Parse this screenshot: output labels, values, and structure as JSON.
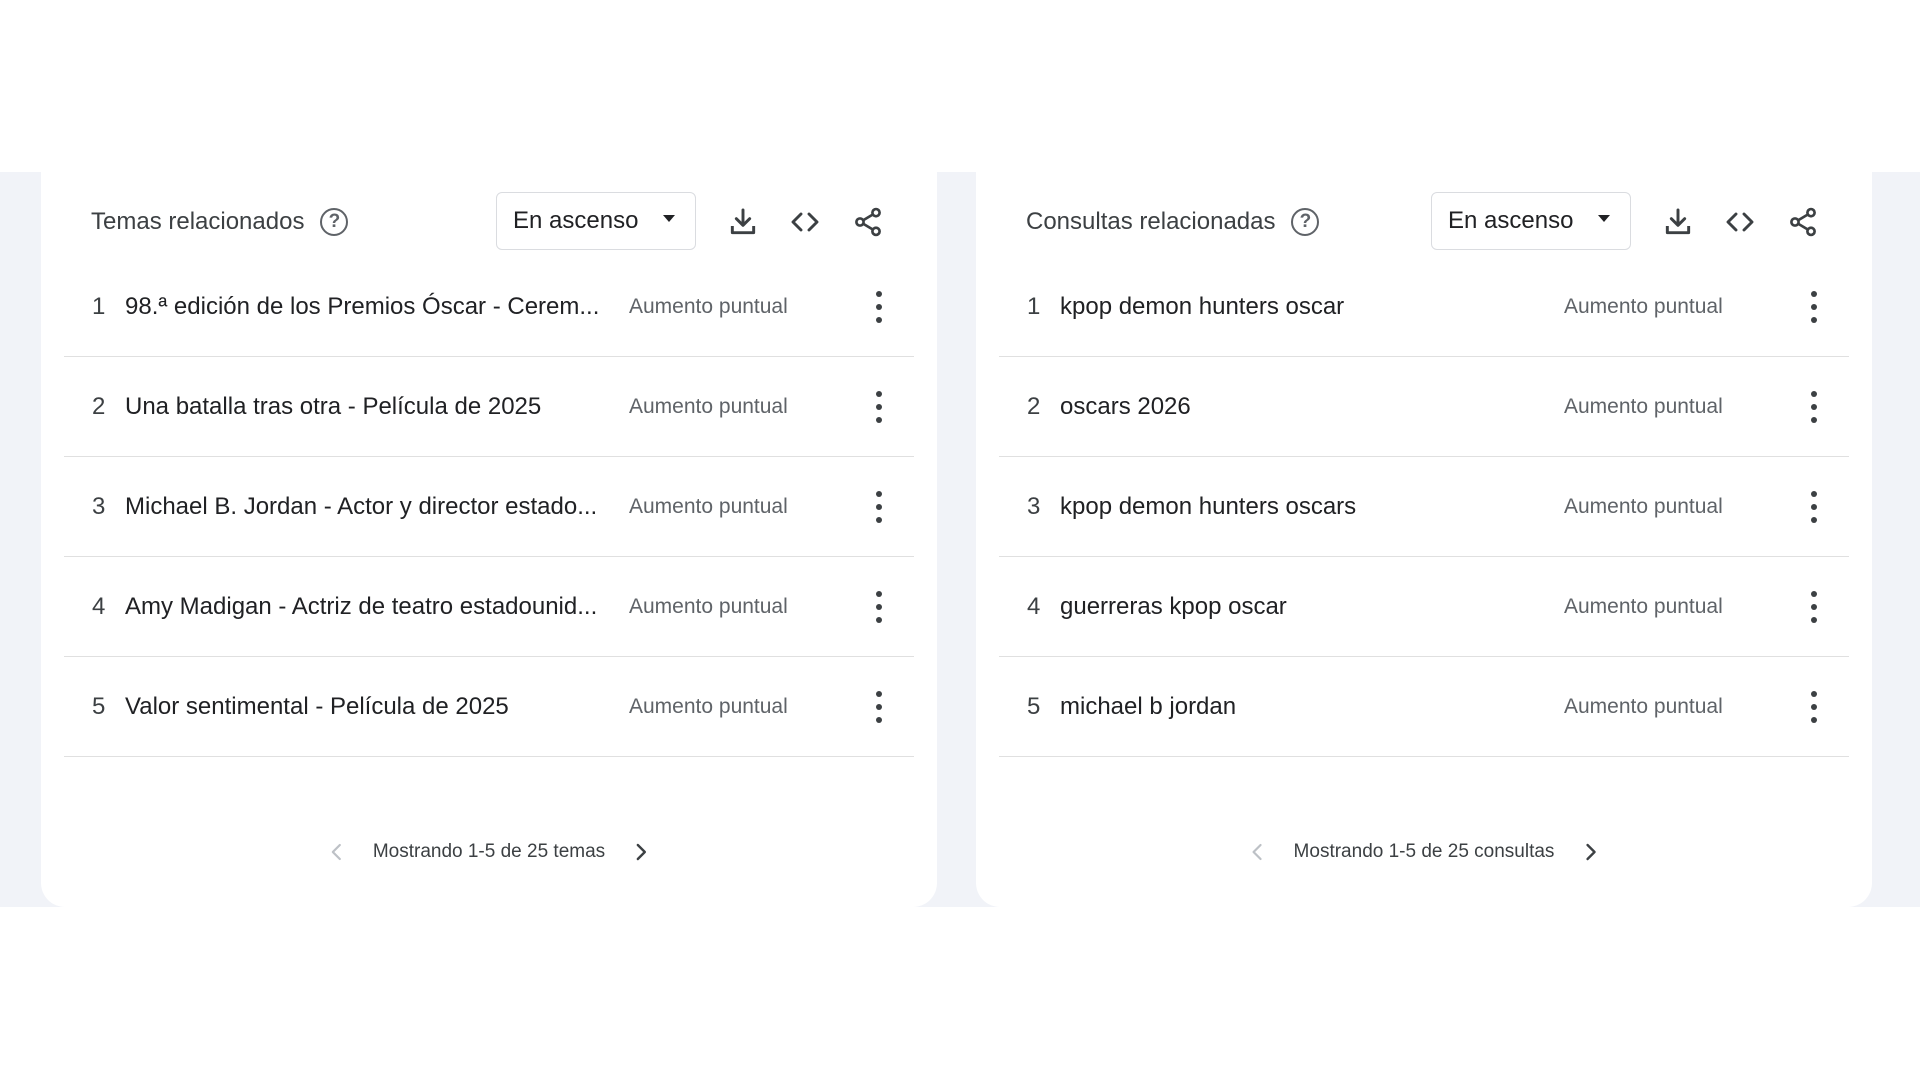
{
  "colors": {
    "band_background": "#f1f3f8",
    "card_background": "#ffffff",
    "primary_text": "#202124",
    "secondary_text": "#5f6368",
    "divider": "#e0e0e0"
  },
  "topics": {
    "title": "Temas relacionados",
    "help_icon": "help-circle-icon",
    "help_glyph": "?",
    "dropdown": {
      "selected": "En ascenso",
      "icon": "caret-down-icon"
    },
    "tools": [
      "download-icon",
      "embed-code-icon",
      "share-icon"
    ],
    "items": [
      {
        "rank": "1",
        "label": "98.ª edición de los Premios Óscar - Cerem...",
        "value": "Aumento puntual"
      },
      {
        "rank": "2",
        "label": "Una batalla tras otra - Película de 2025",
        "value": "Aumento puntual"
      },
      {
        "rank": "3",
        "label": "Michael B. Jordan - Actor y director estado...",
        "value": "Aumento puntual"
      },
      {
        "rank": "4",
        "label": "Amy Madigan - Actriz de teatro estadounid...",
        "value": "Aumento puntual"
      },
      {
        "rank": "5",
        "label": "Valor sentimental - Película de 2025",
        "value": "Aumento puntual"
      }
    ],
    "pagination": {
      "text": "Mostrando 1-5 de 25 temas",
      "prev_enabled": false,
      "next_enabled": true
    }
  },
  "queries": {
    "title": "Consultas relacionadas",
    "help_icon": "help-circle-icon",
    "help_glyph": "?",
    "dropdown": {
      "selected": "En ascenso",
      "icon": "caret-down-icon"
    },
    "tools": [
      "download-icon",
      "embed-code-icon",
      "share-icon"
    ],
    "items": [
      {
        "rank": "1",
        "label": "kpop demon hunters oscar",
        "value": "Aumento puntual"
      },
      {
        "rank": "2",
        "label": "oscars 2026",
        "value": "Aumento puntual"
      },
      {
        "rank": "3",
        "label": "kpop demon hunters oscars",
        "value": "Aumento puntual"
      },
      {
        "rank": "4",
        "label": "guerreras kpop oscar",
        "value": "Aumento puntual"
      },
      {
        "rank": "5",
        "label": "michael b jordan",
        "value": "Aumento puntual"
      }
    ],
    "pagination": {
      "text": "Mostrando 1-5 de 25 consultas",
      "prev_enabled": false,
      "next_enabled": true
    }
  }
}
